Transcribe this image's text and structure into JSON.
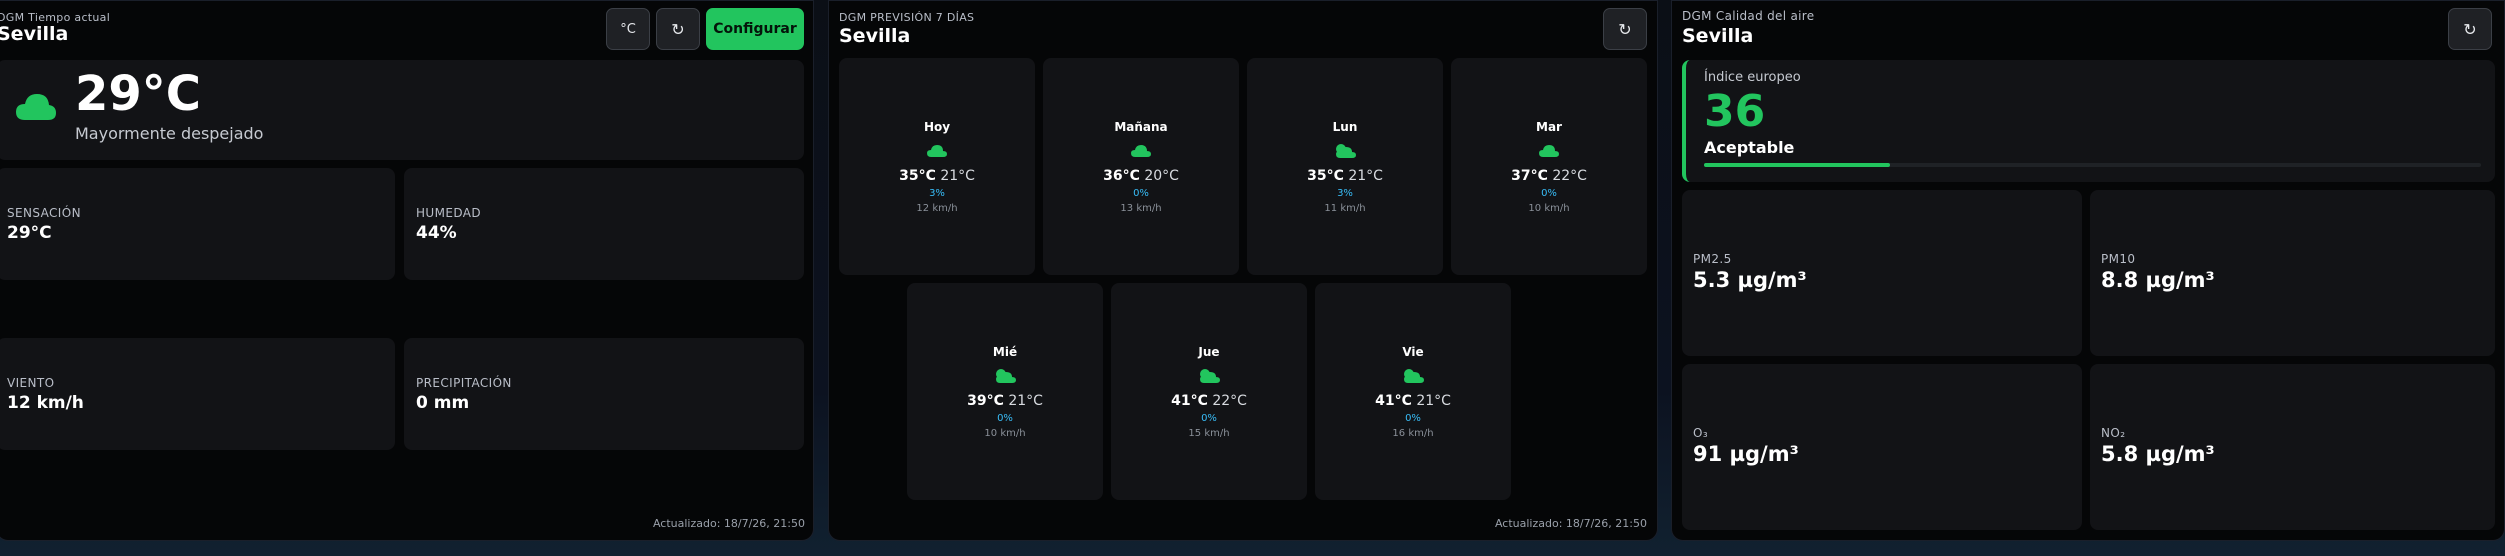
{
  "current": {
    "subtitle": "DGM Tiempo actual",
    "city": "Sevilla",
    "unit_button": "°C",
    "refresh_icon": "↻",
    "configure_button": "Configurar",
    "temperature": "29°C",
    "condition": "Mayormente despejado",
    "icon": "cloud-icon",
    "stats": [
      {
        "label": "SENSACIÓN",
        "value": "29°C"
      },
      {
        "label": "HUMEDAD",
        "value": "44%"
      },
      {
        "label": "VIENTO",
        "value": "12 km/h"
      },
      {
        "label": "PRECIPITACIÓN",
        "value": "0 mm"
      }
    ],
    "updated": "Actualizado: 18/7/26, 21:50"
  },
  "forecast": {
    "subtitle": "DGM PREVISIÓN 7 DÍAS",
    "city": "Sevilla",
    "refresh_icon": "↻",
    "days": [
      {
        "name": "Hoy",
        "max": "35°C",
        "min": "21°C",
        "rain": "3%",
        "wind": "12 km/h",
        "icon": "cloud-icon"
      },
      {
        "name": "Mañana",
        "max": "36°C",
        "min": "20°C",
        "rain": "0%",
        "wind": "13 km/h",
        "icon": "cloud-icon"
      },
      {
        "name": "Lun",
        "max": "35°C",
        "min": "21°C",
        "rain": "3%",
        "wind": "11 km/h",
        "icon": "partly-cloudy-icon"
      },
      {
        "name": "Mar",
        "max": "37°C",
        "min": "22°C",
        "rain": "0%",
        "wind": "10 km/h",
        "icon": "cloud-icon"
      },
      {
        "name": "Mié",
        "max": "39°C",
        "min": "21°C",
        "rain": "0%",
        "wind": "10 km/h",
        "icon": "partly-cloudy-icon"
      },
      {
        "name": "Jue",
        "max": "41°C",
        "min": "22°C",
        "rain": "0%",
        "wind": "15 km/h",
        "icon": "partly-cloudy-icon"
      },
      {
        "name": "Vie",
        "max": "41°C",
        "min": "21°C",
        "rain": "0%",
        "wind": "16 km/h",
        "icon": "partly-cloudy-icon"
      }
    ],
    "updated": "Actualizado: 18/7/26, 21:50"
  },
  "air": {
    "subtitle": "DGM Calidad del aire",
    "city": "Sevilla",
    "refresh_icon": "↻",
    "index_label": "Índice europeo",
    "index_value": "36",
    "index_status": "Aceptable",
    "index_fraction": 0.24,
    "pollutants": [
      {
        "label": "PM2.5",
        "value": "5.3 µg/m³"
      },
      {
        "label": "PM10",
        "value": "8.8 µg/m³"
      },
      {
        "label": "O₃",
        "value": "91 µg/m³"
      },
      {
        "label": "NO₂",
        "value": "5.8 µg/m³"
      }
    ]
  },
  "colors": {
    "accent": "#22c55e",
    "rain": "#38bdf8",
    "card": "#121316",
    "panel": "#050607"
  }
}
